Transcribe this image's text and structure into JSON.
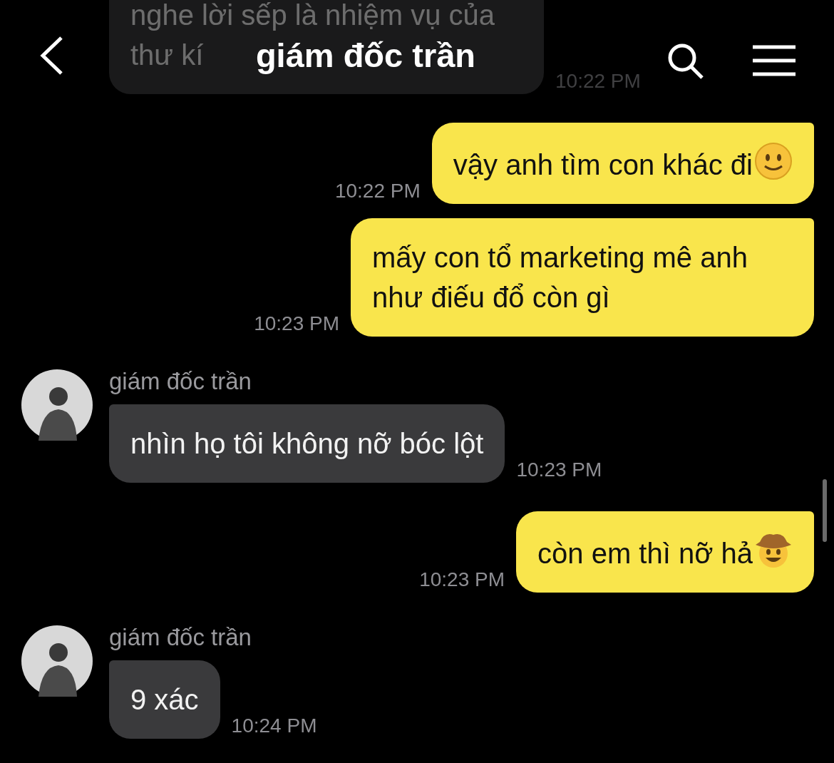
{
  "header": {
    "title": "giám đốc trần"
  },
  "messages": [
    {
      "kind": "received",
      "text": "nghe lời sếp là nhiệm vụ của thư kí",
      "time": "10:22 PM"
    },
    {
      "kind": "sent",
      "text": "vậy anh tìm con khác đi",
      "emoji": {
        "kind": "smile"
      },
      "time": "10:22 PM"
    },
    {
      "kind": "sent",
      "text": "mấy con tổ marketing mê anh như điếu đổ còn gì",
      "time": "10:23 PM"
    },
    {
      "kind": "received",
      "sender": "giám đốc trần",
      "text": "nhìn họ tôi không nỡ bóc lột",
      "time": "10:23 PM"
    },
    {
      "kind": "sent",
      "text": "còn em thì nỡ hả",
      "emoji": {
        "kind": "cowboy"
      },
      "time": "10:23 PM"
    },
    {
      "kind": "received",
      "sender": "giám đốc trần",
      "text": "9 xác",
      "time": "10:24 PM"
    }
  ]
}
